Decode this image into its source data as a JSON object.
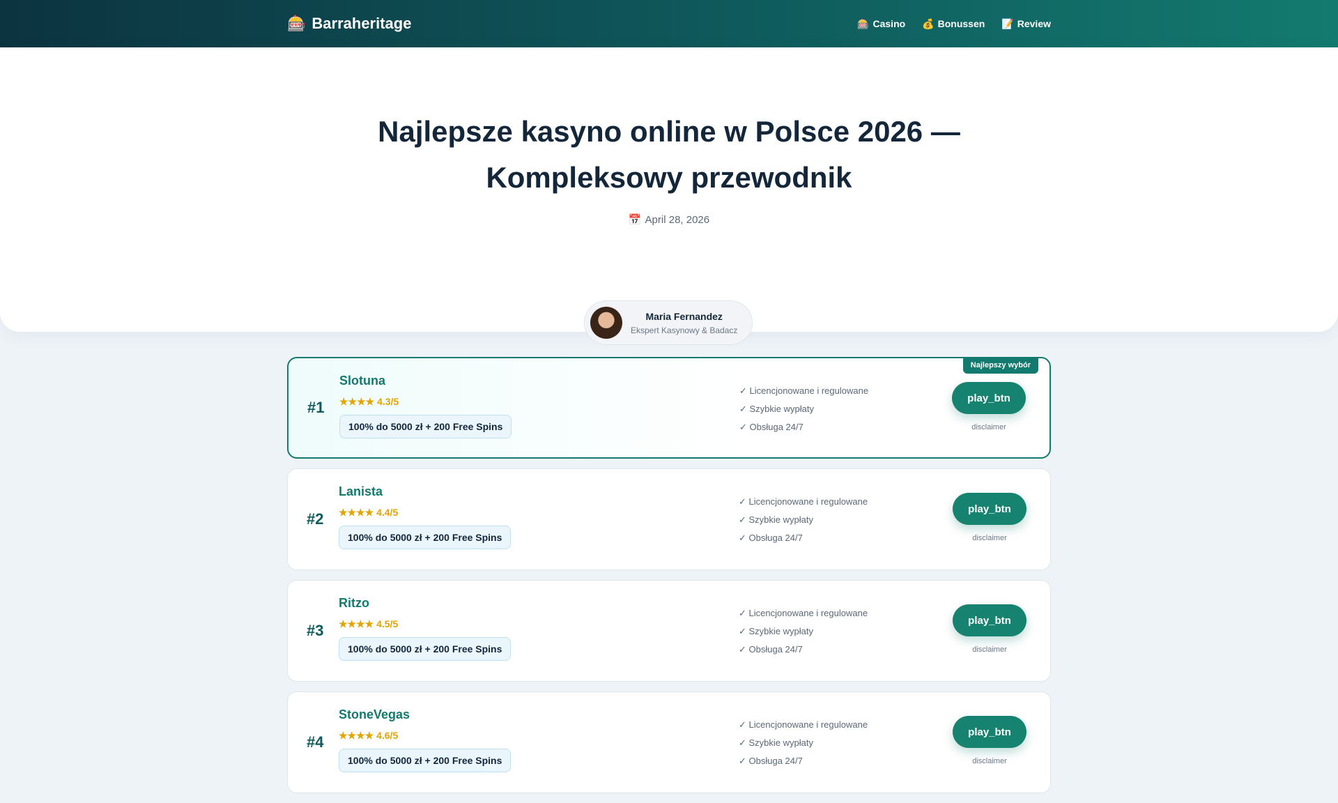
{
  "header": {
    "logo_icon": "slot-machine-icon",
    "site_name": "Barraheritage",
    "nav": [
      {
        "icon": "🎰",
        "label": "Casino"
      },
      {
        "icon": "💰",
        "label": "Bonussen"
      },
      {
        "icon": "📝",
        "label": "Review"
      }
    ]
  },
  "hero": {
    "title": "Najlepsze kasyno online w Polsce 2026 — Kompleksowy przewodnik",
    "date_icon": "📅",
    "date": "April 28, 2026",
    "author": {
      "name": "Maria Fernandez",
      "role": "Ekspert Kasynowy & Badacz"
    }
  },
  "casinos": [
    {
      "rank": "#1",
      "name": "Slotuna",
      "rating": "★★★★ 4.3/5",
      "bonus": "100% do 5000 zł + 200 Free Spins",
      "badge": "Najlepszy wybór",
      "features": [
        "✓ Licencjonowane i regulowane",
        "✓ Szybkie wypłaty",
        "✓ Obsługa 24/7"
      ],
      "button": "play_btn",
      "disclaimer": "disclaimer"
    },
    {
      "rank": "#2",
      "name": "Lanista",
      "rating": "★★★★ 4.4/5",
      "bonus": "100% do 5000 zł + 200 Free Spins",
      "features": [
        "✓ Licencjonowane i regulowane",
        "✓ Szybkie wypłaty",
        "✓ Obsługa 24/7"
      ],
      "button": "play_btn",
      "disclaimer": "disclaimer"
    },
    {
      "rank": "#3",
      "name": "Ritzo",
      "rating": "★★★★ 4.5/5",
      "bonus": "100% do 5000 zł + 200 Free Spins",
      "features": [
        "✓ Licencjonowane i regulowane",
        "✓ Szybkie wypłaty",
        "✓ Obsługa 24/7"
      ],
      "button": "play_btn",
      "disclaimer": "disclaimer"
    },
    {
      "rank": "#4",
      "name": "StoneVegas",
      "rating": "★★★★ 4.6/5",
      "bonus": "100% do 5000 zł + 200 Free Spins",
      "features": [
        "✓ Licencjonowane i regulowane",
        "✓ Szybkie wypłaty",
        "✓ Obsługa 24/7"
      ],
      "button": "play_btn",
      "disclaimer": "disclaimer"
    }
  ],
  "colors": {
    "header_start": "#0c3340",
    "header_end": "#137a6f",
    "accent": "#137a6f",
    "button": "#15836f",
    "star": "#e2a400"
  }
}
